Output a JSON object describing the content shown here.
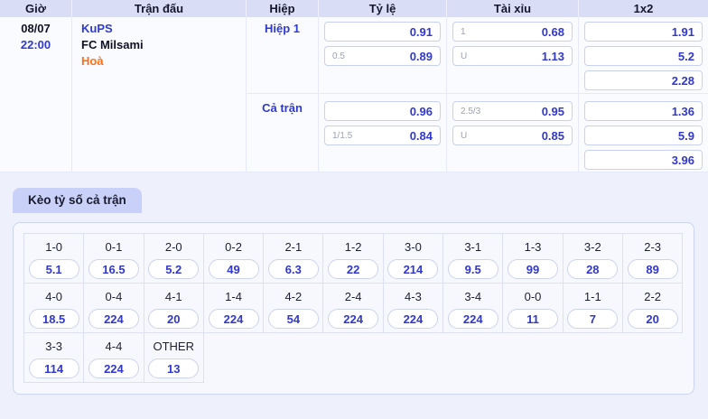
{
  "colors": {
    "page_background": "#eef1fb",
    "header_background": "#d9ddf6",
    "table_background": "#fafbff",
    "accent_blue": "#2f3ad1",
    "odds_blue": "#3038cf",
    "draw_orange": "#ff6f16",
    "tab_background": "#c9d1f8",
    "panel_background": "#f6f8fe"
  },
  "match_table": {
    "headers": [
      "Giờ",
      "Trận đấu",
      "Hiệp",
      "Tỷ lệ",
      "Tài xỉu",
      "1x2"
    ],
    "date": "08/07",
    "time": "22:00",
    "home_team": "KuPS",
    "away_team": "FC Milsami",
    "draw_label": "Hoà",
    "periods": [
      {
        "label": "Hiệp 1",
        "handicap": [
          {
            "line": "",
            "odds": "0.91"
          },
          {
            "line": "0.5",
            "odds": "0.89"
          }
        ],
        "over_under": [
          {
            "line": "1",
            "odds": "0.68"
          },
          {
            "line": "U",
            "odds": "1.13"
          }
        ],
        "one_x_two": [
          "1.91",
          "5.2",
          "2.28"
        ]
      },
      {
        "label": "Cả trận",
        "handicap": [
          {
            "line": "",
            "odds": "0.96"
          },
          {
            "line": "1/1.5",
            "odds": "0.84"
          }
        ],
        "over_under": [
          {
            "line": "2.5/3",
            "odds": "0.95"
          },
          {
            "line": "U",
            "odds": "0.85"
          }
        ],
        "one_x_two": [
          "1.36",
          "5.9",
          "3.96"
        ]
      }
    ]
  },
  "correct_score": {
    "tab_label": "Kèo tỷ số cả trận",
    "rows": [
      [
        {
          "score": "1-0",
          "odds": "5.1"
        },
        {
          "score": "0-1",
          "odds": "16.5"
        },
        {
          "score": "2-0",
          "odds": "5.2"
        },
        {
          "score": "0-2",
          "odds": "49"
        },
        {
          "score": "2-1",
          "odds": "6.3"
        },
        {
          "score": "1-2",
          "odds": "22"
        },
        {
          "score": "3-0",
          "odds": "214"
        },
        {
          "score": "3-1",
          "odds": "9.5"
        },
        {
          "score": "1-3",
          "odds": "99"
        },
        {
          "score": "3-2",
          "odds": "28"
        },
        {
          "score": "2-3",
          "odds": "89"
        }
      ],
      [
        {
          "score": "4-0",
          "odds": "18.5"
        },
        {
          "score": "0-4",
          "odds": "224"
        },
        {
          "score": "4-1",
          "odds": "20"
        },
        {
          "score": "1-4",
          "odds": "224"
        },
        {
          "score": "4-2",
          "odds": "54"
        },
        {
          "score": "2-4",
          "odds": "224"
        },
        {
          "score": "4-3",
          "odds": "224"
        },
        {
          "score": "3-4",
          "odds": "224"
        },
        {
          "score": "0-0",
          "odds": "11"
        },
        {
          "score": "1-1",
          "odds": "7"
        },
        {
          "score": "2-2",
          "odds": "20"
        }
      ],
      [
        {
          "score": "3-3",
          "odds": "114"
        },
        {
          "score": "4-4",
          "odds": "224"
        },
        {
          "score": "OTHER",
          "odds": "13"
        }
      ]
    ]
  }
}
